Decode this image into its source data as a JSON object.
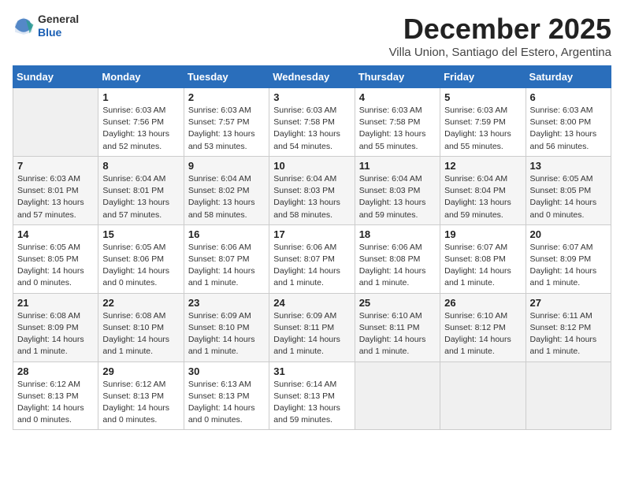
{
  "header": {
    "logo": {
      "general": "General",
      "blue": "Blue"
    },
    "month": "December 2025",
    "location": "Villa Union, Santiago del Estero, Argentina"
  },
  "calendar": {
    "days_of_week": [
      "Sunday",
      "Monday",
      "Tuesday",
      "Wednesday",
      "Thursday",
      "Friday",
      "Saturday"
    ],
    "weeks": [
      [
        {
          "day": "",
          "empty": true
        },
        {
          "day": "1",
          "sunrise": "6:03 AM",
          "sunset": "7:56 PM",
          "daylight": "13 hours and 52 minutes."
        },
        {
          "day": "2",
          "sunrise": "6:03 AM",
          "sunset": "7:57 PM",
          "daylight": "13 hours and 53 minutes."
        },
        {
          "day": "3",
          "sunrise": "6:03 AM",
          "sunset": "7:58 PM",
          "daylight": "13 hours and 54 minutes."
        },
        {
          "day": "4",
          "sunrise": "6:03 AM",
          "sunset": "7:58 PM",
          "daylight": "13 hours and 55 minutes."
        },
        {
          "day": "5",
          "sunrise": "6:03 AM",
          "sunset": "7:59 PM",
          "daylight": "13 hours and 55 minutes."
        },
        {
          "day": "6",
          "sunrise": "6:03 AM",
          "sunset": "8:00 PM",
          "daylight": "13 hours and 56 minutes."
        }
      ],
      [
        {
          "day": "7",
          "sunrise": "6:03 AM",
          "sunset": "8:01 PM",
          "daylight": "13 hours and 57 minutes."
        },
        {
          "day": "8",
          "sunrise": "6:04 AM",
          "sunset": "8:01 PM",
          "daylight": "13 hours and 57 minutes."
        },
        {
          "day": "9",
          "sunrise": "6:04 AM",
          "sunset": "8:02 PM",
          "daylight": "13 hours and 58 minutes."
        },
        {
          "day": "10",
          "sunrise": "6:04 AM",
          "sunset": "8:03 PM",
          "daylight": "13 hours and 58 minutes."
        },
        {
          "day": "11",
          "sunrise": "6:04 AM",
          "sunset": "8:03 PM",
          "daylight": "13 hours and 59 minutes."
        },
        {
          "day": "12",
          "sunrise": "6:04 AM",
          "sunset": "8:04 PM",
          "daylight": "13 hours and 59 minutes."
        },
        {
          "day": "13",
          "sunrise": "6:05 AM",
          "sunset": "8:05 PM",
          "daylight": "14 hours and 0 minutes."
        }
      ],
      [
        {
          "day": "14",
          "sunrise": "6:05 AM",
          "sunset": "8:05 PM",
          "daylight": "14 hours and 0 minutes."
        },
        {
          "day": "15",
          "sunrise": "6:05 AM",
          "sunset": "8:06 PM",
          "daylight": "14 hours and 0 minutes."
        },
        {
          "day": "16",
          "sunrise": "6:06 AM",
          "sunset": "8:07 PM",
          "daylight": "14 hours and 1 minute."
        },
        {
          "day": "17",
          "sunrise": "6:06 AM",
          "sunset": "8:07 PM",
          "daylight": "14 hours and 1 minute."
        },
        {
          "day": "18",
          "sunrise": "6:06 AM",
          "sunset": "8:08 PM",
          "daylight": "14 hours and 1 minute."
        },
        {
          "day": "19",
          "sunrise": "6:07 AM",
          "sunset": "8:08 PM",
          "daylight": "14 hours and 1 minute."
        },
        {
          "day": "20",
          "sunrise": "6:07 AM",
          "sunset": "8:09 PM",
          "daylight": "14 hours and 1 minute."
        }
      ],
      [
        {
          "day": "21",
          "sunrise": "6:08 AM",
          "sunset": "8:09 PM",
          "daylight": "14 hours and 1 minute."
        },
        {
          "day": "22",
          "sunrise": "6:08 AM",
          "sunset": "8:10 PM",
          "daylight": "14 hours and 1 minute."
        },
        {
          "day": "23",
          "sunrise": "6:09 AM",
          "sunset": "8:10 PM",
          "daylight": "14 hours and 1 minute."
        },
        {
          "day": "24",
          "sunrise": "6:09 AM",
          "sunset": "8:11 PM",
          "daylight": "14 hours and 1 minute."
        },
        {
          "day": "25",
          "sunrise": "6:10 AM",
          "sunset": "8:11 PM",
          "daylight": "14 hours and 1 minute."
        },
        {
          "day": "26",
          "sunrise": "6:10 AM",
          "sunset": "8:12 PM",
          "daylight": "14 hours and 1 minute."
        },
        {
          "day": "27",
          "sunrise": "6:11 AM",
          "sunset": "8:12 PM",
          "daylight": "14 hours and 1 minute."
        }
      ],
      [
        {
          "day": "28",
          "sunrise": "6:12 AM",
          "sunset": "8:13 PM",
          "daylight": "14 hours and 0 minutes."
        },
        {
          "day": "29",
          "sunrise": "6:12 AM",
          "sunset": "8:13 PM",
          "daylight": "14 hours and 0 minutes."
        },
        {
          "day": "30",
          "sunrise": "6:13 AM",
          "sunset": "8:13 PM",
          "daylight": "14 hours and 0 minutes."
        },
        {
          "day": "31",
          "sunrise": "6:14 AM",
          "sunset": "8:13 PM",
          "daylight": "13 hours and 59 minutes."
        },
        {
          "day": "",
          "empty": true
        },
        {
          "day": "",
          "empty": true
        },
        {
          "day": "",
          "empty": true
        }
      ]
    ]
  }
}
